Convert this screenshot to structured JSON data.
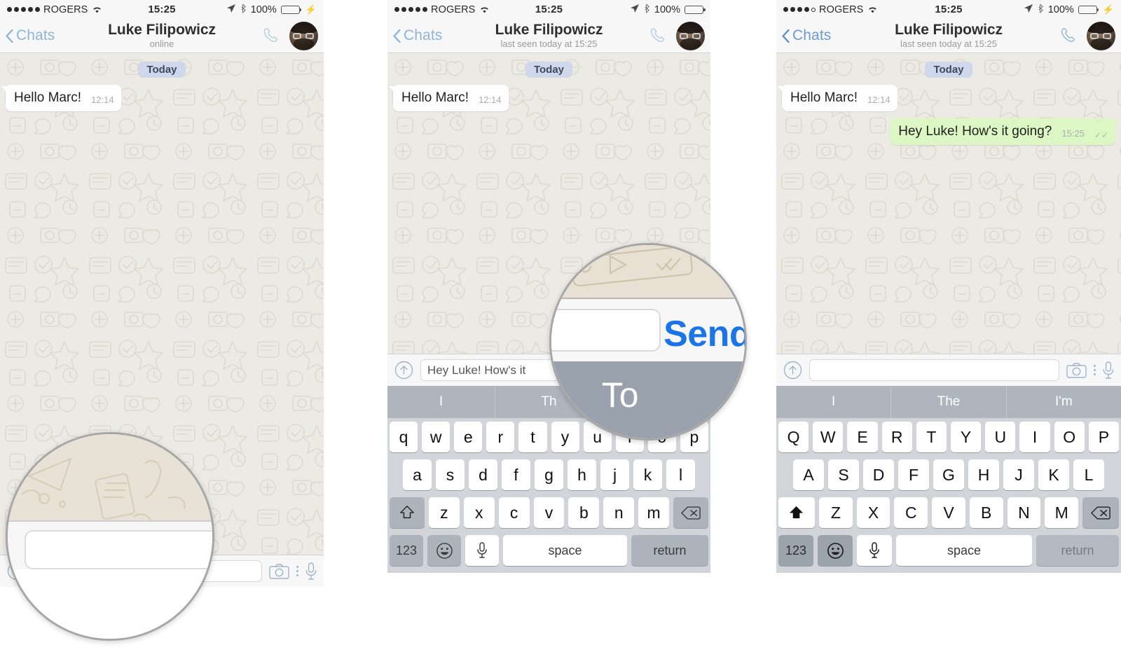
{
  "status_bar": {
    "carrier": "ROGERS",
    "time": "15:25",
    "battery_pct": "100%",
    "signal_dots_filled_p1": 5,
    "signal_dots_filled_p3": 4,
    "icons": [
      "location-arrow-icon",
      "bluetooth-icon",
      "battery-icon",
      "charging-bolt-icon",
      "wifi-icon"
    ]
  },
  "nav": {
    "back_label": "Chats",
    "title": "Luke Filipowicz",
    "subtitle_online": "online",
    "subtitle_lastseen": "last seen today at 15:25",
    "call_icon": "phone-icon",
    "avatar": "contact-avatar"
  },
  "chat": {
    "day_badge": "Today",
    "messages": [
      {
        "text": "Hello Marc!",
        "time": "12:14",
        "direction": "in"
      },
      {
        "text": "Hey Luke! How's it going?",
        "time": "15:25",
        "direction": "out",
        "ticks": "✓✓"
      }
    ]
  },
  "input_bar": {
    "attach_icon": "attach-up-arrow-icon",
    "placeholder": "",
    "value_panel1": "",
    "value_panel2": "Hey Luke! How's it",
    "value_panel3": "",
    "camera_icon": "camera-icon",
    "more_icon": "more-vertical-icon",
    "mic_icon": "microphone-icon"
  },
  "keyboard": {
    "predictions_lower": [
      "I",
      "Th",
      "To"
    ],
    "predictions_upper": [
      "I",
      "The",
      "I'm"
    ],
    "rows_lower": [
      [
        "q",
        "w",
        "e",
        "r",
        "t",
        "y",
        "u",
        "i",
        "o",
        "p"
      ],
      [
        "a",
        "s",
        "d",
        "f",
        "g",
        "h",
        "j",
        "k",
        "l"
      ],
      [
        "z",
        "x",
        "c",
        "v",
        "b",
        "n",
        "m"
      ]
    ],
    "rows_upper": [
      [
        "Q",
        "W",
        "E",
        "R",
        "T",
        "Y",
        "U",
        "I",
        "O",
        "P"
      ],
      [
        "A",
        "S",
        "D",
        "F",
        "G",
        "H",
        "J",
        "K",
        "L"
      ],
      [
        "Z",
        "X",
        "C",
        "V",
        "B",
        "N",
        "M"
      ]
    ],
    "shift_key": "shift-icon",
    "backspace_key": "backspace-icon",
    "numbers_key": "123",
    "emoji_key": "emoji-icon",
    "dictation_key": "microphone-icon",
    "space_key": "space",
    "return_key": "return"
  },
  "magnifiers": {
    "panel1_caption": "text-input-field-magnified",
    "panel2_send_label": "Send",
    "panel2_partial_prediction": "To"
  },
  "colors": {
    "accent_blue": "#1b74e8",
    "back_link_blue": "#8fb4d9",
    "sent_bubble_green": "#dcf7c4",
    "day_badge_blue": "#cfd8ea",
    "battery_green": "#4cd964",
    "keyboard_bg": "#d1d5da",
    "predict_bg": "#aeb5bd",
    "icon_blue_gray": "#9db6cb"
  }
}
